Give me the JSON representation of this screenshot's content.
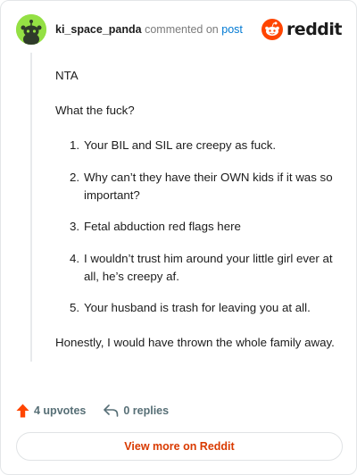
{
  "header": {
    "username": "ki_space_panda",
    "verb": "commented on",
    "post_link": "post",
    "brand": "reddit",
    "avatar_icon": "snoo-avatar-icon",
    "logo_icon": "reddit-snoo-icon",
    "brand_color": "#ff4500"
  },
  "comment": {
    "p1": "NTA",
    "p2": "What the fuck?",
    "list": [
      {
        "num": "1.",
        "text": "Your BIL and SIL are creepy as fuck."
      },
      {
        "num": "2.",
        "text": "Why can’t they have their OWN kids if it was so important?"
      },
      {
        "num": "3.",
        "text": "Fetal abduction red flags here"
      },
      {
        "num": "4.",
        "text": "I wouldn’t trust him around your little girl ever at all, he’s creepy af."
      },
      {
        "num": "5.",
        "text": "Your husband is trash for leaving you at all."
      }
    ],
    "p3": "Honestly, I would have thrown the whole family away."
  },
  "actions": {
    "upvotes": "4 upvotes",
    "replies": "0 replies",
    "upvote_icon": "upvote-arrow-icon",
    "reply_icon": "reply-arrow-icon",
    "upvote_color": "#ff4500"
  },
  "footer": {
    "view_more": "View more on Reddit",
    "accent": "#d93a00"
  }
}
